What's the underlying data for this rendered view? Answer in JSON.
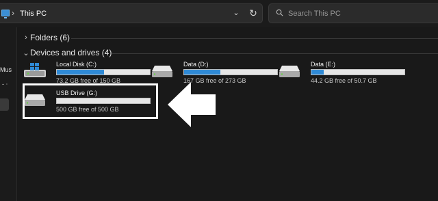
{
  "address": {
    "location": "This PC",
    "separator": "›"
  },
  "search": {
    "placeholder": "Search This PC"
  },
  "nav": {
    "partial_label": "Mus",
    "partial_mark": "- ⋅"
  },
  "groups": {
    "folders": {
      "label": "Folders (6)",
      "expanded": false
    },
    "devices": {
      "label": "Devices and drives (4)",
      "expanded": true
    }
  },
  "drives": [
    {
      "name": "Local Disk (C:)",
      "free": "73.2 GB free of 150 GB",
      "used_fraction": 0.51,
      "icon": "windows-drive-icon"
    },
    {
      "name": "Data (D:)",
      "free": "167 GB free of 273 GB",
      "used_fraction": 0.39,
      "icon": "hard-drive-icon"
    },
    {
      "name": "Data (E:)",
      "free": "44.2 GB free of 50.7 GB",
      "used_fraction": 0.13,
      "icon": "hard-drive-icon"
    },
    {
      "name": "USB Drive (G:)",
      "free": "500 GB free of 500 GB",
      "used_fraction": 0.0,
      "icon": "usb-drive-icon"
    }
  ],
  "annotation": {
    "highlighted_drive": "USB Drive (G:)",
    "arrow_color": "#ffffff",
    "box_color": "#ffffff"
  },
  "colors": {
    "bar_fill": "#2f8ad6",
    "bar_bg": "#e6e6e6",
    "background": "#1b1b1b"
  }
}
